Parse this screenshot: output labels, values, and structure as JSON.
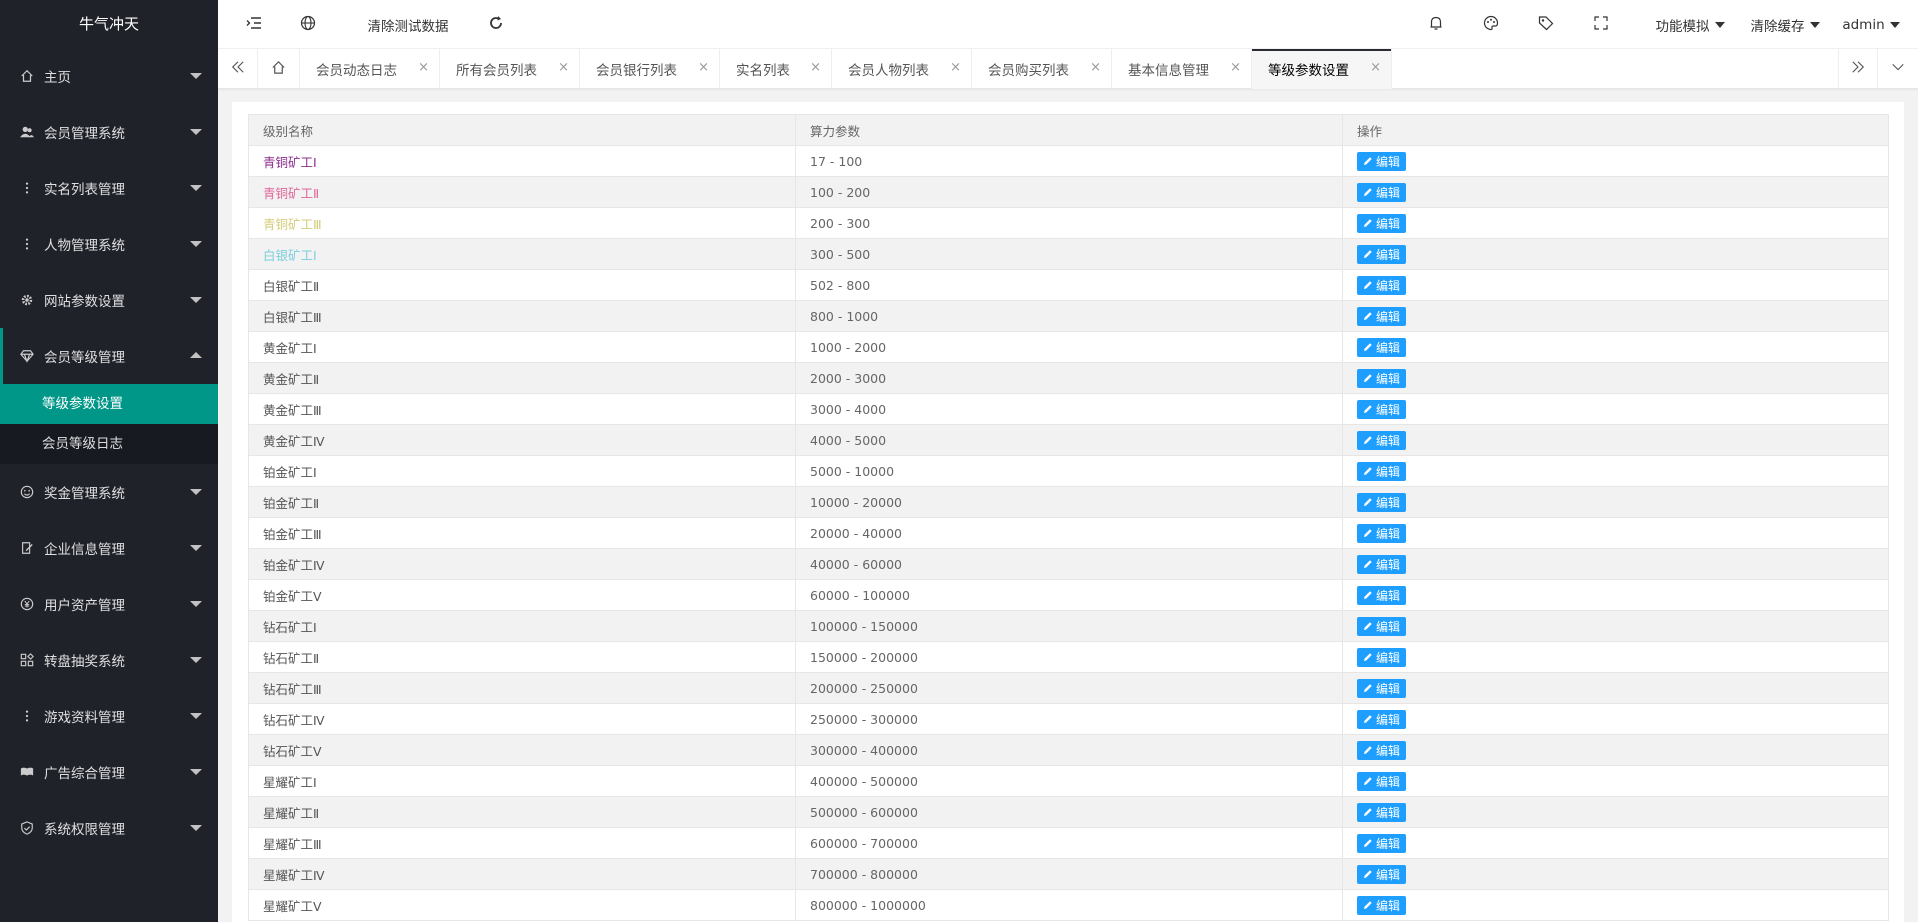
{
  "app": {
    "title": "牛气冲天"
  },
  "sidebar": {
    "items": [
      {
        "label": "主页",
        "icon": "home-icon"
      },
      {
        "label": "会员管理系统",
        "icon": "users-icon"
      },
      {
        "label": "实名列表管理",
        "icon": "dots-vertical-icon"
      },
      {
        "label": "人物管理系统",
        "icon": "dots-vertical-icon"
      },
      {
        "label": "网站参数设置",
        "icon": "gear-icon"
      },
      {
        "label": "会员等级管理",
        "icon": "diamond-icon",
        "expanded": true
      },
      {
        "label": "奖金管理系统",
        "icon": "smile-icon"
      },
      {
        "label": "企业信息管理",
        "icon": "edit-doc-icon"
      },
      {
        "label": "用户资产管理",
        "icon": "yen-circle-icon"
      },
      {
        "label": "转盘抽奖系统",
        "icon": "apps-icon"
      },
      {
        "label": "游戏资料管理",
        "icon": "dots-vertical-icon"
      },
      {
        "label": "广告综合管理",
        "icon": "read-icon"
      },
      {
        "label": "系统权限管理",
        "icon": "shield-check-icon"
      }
    ],
    "subitems": [
      {
        "label": "等级参数设置",
        "active": true
      },
      {
        "label": "会员等级日志",
        "active": false
      }
    ]
  },
  "header": {
    "clear_test_data": "清除测试数据",
    "function_sim": "功能模拟",
    "clear_cache": "清除缓存",
    "user": "admin"
  },
  "tabs": [
    {
      "label": "会员动态日志"
    },
    {
      "label": "所有会员列表"
    },
    {
      "label": "会员银行列表"
    },
    {
      "label": "实名列表"
    },
    {
      "label": "会员人物列表"
    },
    {
      "label": "会员购买列表"
    },
    {
      "label": "基本信息管理"
    },
    {
      "label": "等级参数设置",
      "active": true
    }
  ],
  "tab_close_glyph": "×",
  "table": {
    "columns": [
      "级别名称",
      "算力参数",
      "操作"
    ],
    "edit_label": "编辑",
    "rows": [
      {
        "name": "青铜矿工Ⅰ",
        "range": "17 - 100",
        "color": "#8e2d8e"
      },
      {
        "name": "青铜矿工Ⅱ",
        "range": "100 - 200",
        "color": "#e0679a"
      },
      {
        "name": "青铜矿工Ⅲ",
        "range": "200 - 300",
        "color": "#d4cd7a"
      },
      {
        "name": "白银矿工Ⅰ",
        "range": "300 - 500",
        "color": "#7ccfe0"
      },
      {
        "name": "白银矿工Ⅱ",
        "range": "502 - 800",
        "color": "#555555"
      },
      {
        "name": "白银矿工Ⅲ",
        "range": "800 - 1000",
        "color": "#555555"
      },
      {
        "name": "黄金矿工Ⅰ",
        "range": "1000 - 2000",
        "color": "#555555"
      },
      {
        "name": "黄金矿工Ⅱ",
        "range": "2000 - 3000",
        "color": "#555555"
      },
      {
        "name": "黄金矿工Ⅲ",
        "range": "3000 - 4000",
        "color": "#555555"
      },
      {
        "name": "黄金矿工Ⅳ",
        "range": "4000 - 5000",
        "color": "#555555"
      },
      {
        "name": "铂金矿工Ⅰ",
        "range": "5000 - 10000",
        "color": "#555555"
      },
      {
        "name": "铂金矿工Ⅱ",
        "range": "10000 - 20000",
        "color": "#555555"
      },
      {
        "name": "铂金矿工Ⅲ",
        "range": "20000 - 40000",
        "color": "#555555"
      },
      {
        "name": "铂金矿工Ⅳ",
        "range": "40000 - 60000",
        "color": "#555555"
      },
      {
        "name": "铂金矿工Ⅴ",
        "range": "60000 - 100000",
        "color": "#555555"
      },
      {
        "name": "钻石矿工Ⅰ",
        "range": "100000 - 150000",
        "color": "#555555"
      },
      {
        "name": "钻石矿工Ⅱ",
        "range": "150000 - 200000",
        "color": "#555555"
      },
      {
        "name": "钻石矿工Ⅲ",
        "range": "200000 - 250000",
        "color": "#555555"
      },
      {
        "name": "钻石矿工Ⅳ",
        "range": "250000 - 300000",
        "color": "#555555"
      },
      {
        "name": "钻石矿工Ⅴ",
        "range": "300000 - 400000",
        "color": "#555555"
      },
      {
        "name": "星耀矿工Ⅰ",
        "range": "400000 - 500000",
        "color": "#555555"
      },
      {
        "name": "星耀矿工Ⅱ",
        "range": "500000 - 600000",
        "color": "#555555"
      },
      {
        "name": "星耀矿工Ⅲ",
        "range": "600000 - 700000",
        "color": "#555555"
      },
      {
        "name": "星耀矿工Ⅳ",
        "range": "700000 - 800000",
        "color": "#555555"
      },
      {
        "name": "星耀矿工Ⅴ",
        "range": "800000 - 1000000",
        "color": "#555555"
      }
    ]
  },
  "colors": {
    "sidebar_bg": "#20222a",
    "accent": "#009688",
    "button_blue": "#1e9fff"
  }
}
